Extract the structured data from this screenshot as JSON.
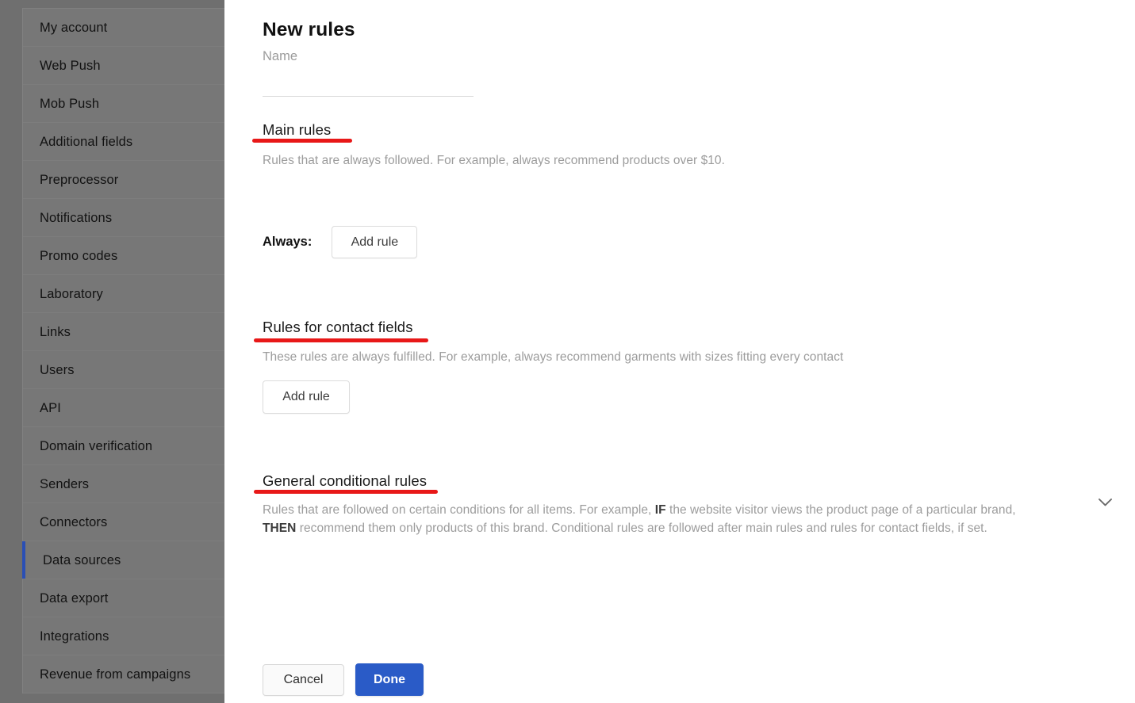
{
  "sidebar": {
    "items": [
      {
        "label": "My account",
        "active": false
      },
      {
        "label": "Web Push",
        "active": false
      },
      {
        "label": "Mob Push",
        "active": false
      },
      {
        "label": "Additional fields",
        "active": false
      },
      {
        "label": "Preprocessor",
        "active": false
      },
      {
        "label": "Notifications",
        "active": false
      },
      {
        "label": "Promo codes",
        "active": false
      },
      {
        "label": "Laboratory",
        "active": false
      },
      {
        "label": "Links",
        "active": false
      },
      {
        "label": "Users",
        "active": false
      },
      {
        "label": "API",
        "active": false
      },
      {
        "label": "Domain verification",
        "active": false
      },
      {
        "label": "Senders",
        "active": false
      },
      {
        "label": "Connectors",
        "active": false
      },
      {
        "label": "Data sources",
        "active": true
      },
      {
        "label": "Data export",
        "active": false
      },
      {
        "label": "Integrations",
        "active": false
      },
      {
        "label": "Revenue from campaigns",
        "active": false
      }
    ],
    "active_accent_color": "#2a4fb5"
  },
  "modal": {
    "title": "New rules",
    "name_field": {
      "placeholder": "Name",
      "value": ""
    },
    "sections": {
      "main_rules": {
        "heading": "Main rules",
        "description": "Rules that are always followed. For example, always recommend products over $10.",
        "always_label": "Always:",
        "add_rule_label": "Add rule"
      },
      "contact_fields": {
        "heading": "Rules for contact fields",
        "description": "These rules are always fulfilled. For example, always recommend garments with sizes fitting every contact",
        "add_rule_label": "Add rule"
      },
      "general_conditional": {
        "heading": "General conditional rules",
        "description_part1": "Rules that are followed on certain conditions for all items. For example, ",
        "description_if": "IF",
        "description_part2": " the website visitor views the product page of a particular brand, ",
        "description_then": "THEN",
        "description_part3": " recommend them only products of this brand. Conditional rules are followed after main rules and rules for contact fields, if set.",
        "expand_icon": "chevron-down-icon"
      }
    },
    "footer": {
      "cancel_label": "Cancel",
      "done_label": "Done",
      "done_color": "#2a5bc7"
    },
    "annotation_color": "#e81818"
  }
}
